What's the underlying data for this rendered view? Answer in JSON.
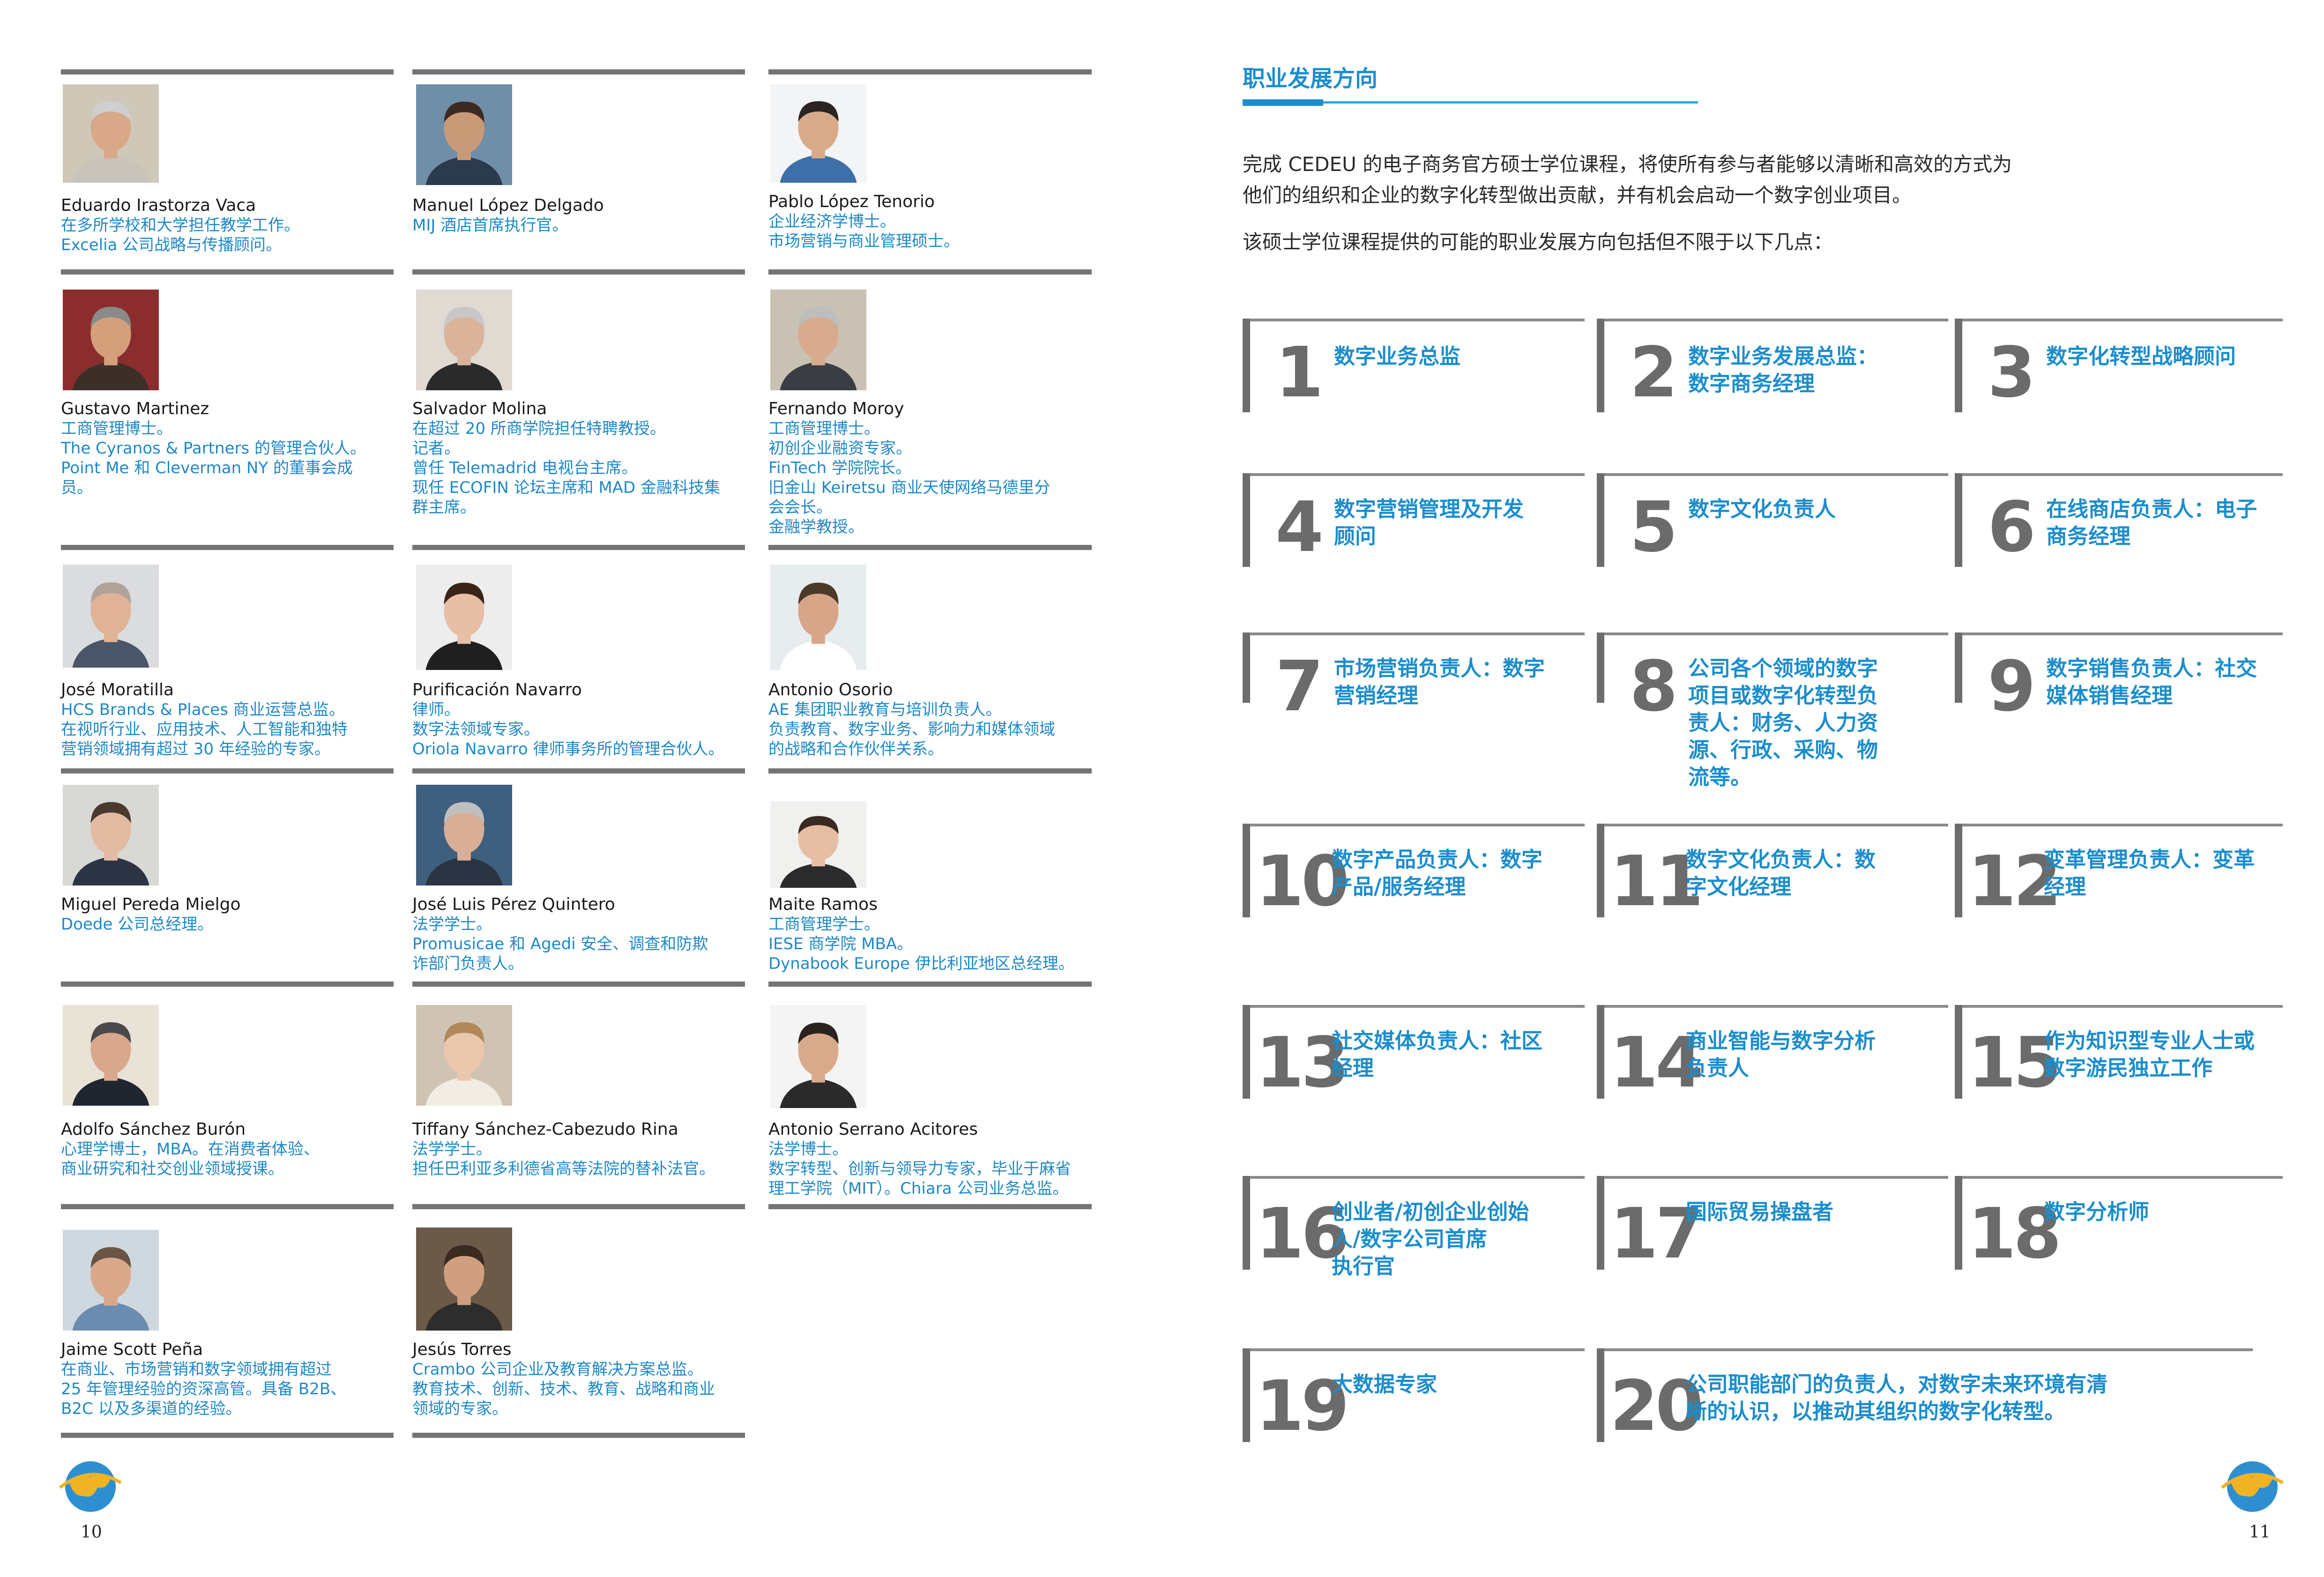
{
  "left_page": {
    "page_number": "10",
    "people": [
      {
        "name": "Eduardo Irastorza Vaca",
        "desc": "在多所学校和大学担任教学工作。\nExcelia 公司战略与传播顾问。"
      },
      {
        "name": "Manuel López Delgado",
        "desc": "MIJ 酒店首席执行官。"
      },
      {
        "name": "Pablo López Tenorio",
        "desc": "企业经济学博士。\n市场营销与商业管理硕士。"
      },
      {
        "name": "Gustavo Martinez",
        "desc": "工商管理博士。\nThe Cyranos & Partners 的管理合伙人。\nPoint Me 和 Cleverman NY 的董事会成\n员。"
      },
      {
        "name": "Salvador Molina",
        "desc": "在超过 20 所商学院担任特聘教授。\n记者。\n曾任 Telemadrid 电视台主席。\n现任 ECOFIN 论坛主席和 MAD 金融科技集\n群主席。"
      },
      {
        "name": "Fernando Moroy",
        "desc": "工商管理博士。\n初创企业融资专家。\nFinTech 学院院长。\n旧金山 Keiretsu 商业天使网络马德里分\n会会长。\n金融学教授。"
      },
      {
        "name": "José Moratilla",
        "desc": "HCS Brands & Places 商业运营总监。\n在视听行业、应用技术、人工智能和独特\n营销领域拥有超过 30 年经验的专家。"
      },
      {
        "name": "Purificación Navarro",
        "desc": "律师。\n数字法领域专家。\nOriola Navarro 律师事务所的管理合伙人。"
      },
      {
        "name": "Antonio Osorio",
        "desc": "AE 集团职业教育与培训负责人。\n负责教育、数字业务、影响力和媒体领域\n的战略和合作伙伴关系。"
      },
      {
        "name": "Miguel Pereda Mielgo",
        "desc": "Doede 公司总经理。"
      },
      {
        "name": "José Luis Pérez Quintero",
        "desc": "法学学士。\nPromusicae 和 Agedi 安全、调查和防欺\n诈部门负责人。"
      },
      {
        "name": "Maite Ramos",
        "desc": "工商管理学士。\nIESE 商学院 MBA。\nDynabook Europe 伊比利亚地区总经理。"
      },
      {
        "name": "Adolfo Sánchez Burón",
        "desc": "心理学博士，MBA。在消费者体验、\n商业研究和社交创业领域授课。"
      },
      {
        "name": "Tiffany Sánchez-Cabezudo Rina",
        "desc": "法学学士。\n担任巴利亚多利德省高等法院的替补法官。"
      },
      {
        "name": "Antonio Serrano Acitores",
        "desc": "法学博士。\n数字转型、创新与领导力专家，毕业于麻省\n理工学院（MIT）。Chiara 公司业务总监。"
      },
      {
        "name": "Jaime Scott Peña",
        "desc": "在商业、市场营销和数字领域拥有超过\n25 年管理经验的资深高管。具备 B2B、\nB2C 以及多渠道的经验。"
      },
      {
        "name": "Jesús Torres",
        "desc": "Crambo 公司企业及教育解决方案总监。\n教育技术、创新、技术、教育、战略和商业\n领域的专家。"
      }
    ]
  },
  "right_page": {
    "page_number": "11",
    "section_title": "职业发展方向",
    "intro_lines": [
      "完成 CEDEU 的电子商务官方硕士学位课程，将使所有参与者能够以清晰和高效的方式为",
      "他们的组织和企业的数字化转型做出贡献，并有机会启动一个数字创业项目。",
      "该硕士学位课程提供的可能的职业发展方向包括但不限于以下几点："
    ],
    "careers": [
      {
        "num": "1",
        "label": "数字业务总监"
      },
      {
        "num": "2",
        "label": "数字业务发展总监：\n数字商务经理"
      },
      {
        "num": "3",
        "label": "数字化转型战略顾问"
      },
      {
        "num": "4",
        "label": "数字营销管理及开发\n顾问"
      },
      {
        "num": "5",
        "label": "数字文化负责人"
      },
      {
        "num": "6",
        "label": "在线商店负责人：电子\n商务经理"
      },
      {
        "num": "7",
        "label": "市场营销负责人：数字\n营销经理"
      },
      {
        "num": "8",
        "label": "公司各个领域的数字\n项目或数字化转型负\n责人：财务、人力资\n源、行政、采购、物\n流等。"
      },
      {
        "num": "9",
        "label": "数字销售负责人：社交\n媒体销售经理"
      },
      {
        "num": "10",
        "label": "数字产品负责人：数字\n产品/服务经理"
      },
      {
        "num": "11",
        "label": "数字文化负责人：数\n字文化经理"
      },
      {
        "num": "12",
        "label": "变革管理负责人：变革\n经理"
      },
      {
        "num": "13",
        "label": "社交媒体负责人：社区\n经理"
      },
      {
        "num": "14",
        "label": "商业智能与数字分析\n负责人"
      },
      {
        "num": "15",
        "label": "作为知识型专业人士或\n数字游民独立工作"
      },
      {
        "num": "16",
        "label": "创业者/初创企业创始\n人/数字公司首席\n执行官"
      },
      {
        "num": "17",
        "label": "国际贸易操盘者"
      },
      {
        "num": "18",
        "label": "数字分析师"
      },
      {
        "num": "19",
        "label": "大数据专家"
      },
      {
        "num": "20",
        "label": "公司职能部门的负责人，对数字未来环境有清\n晰的认识，以推动其组织的数字化转型。"
      }
    ]
  }
}
